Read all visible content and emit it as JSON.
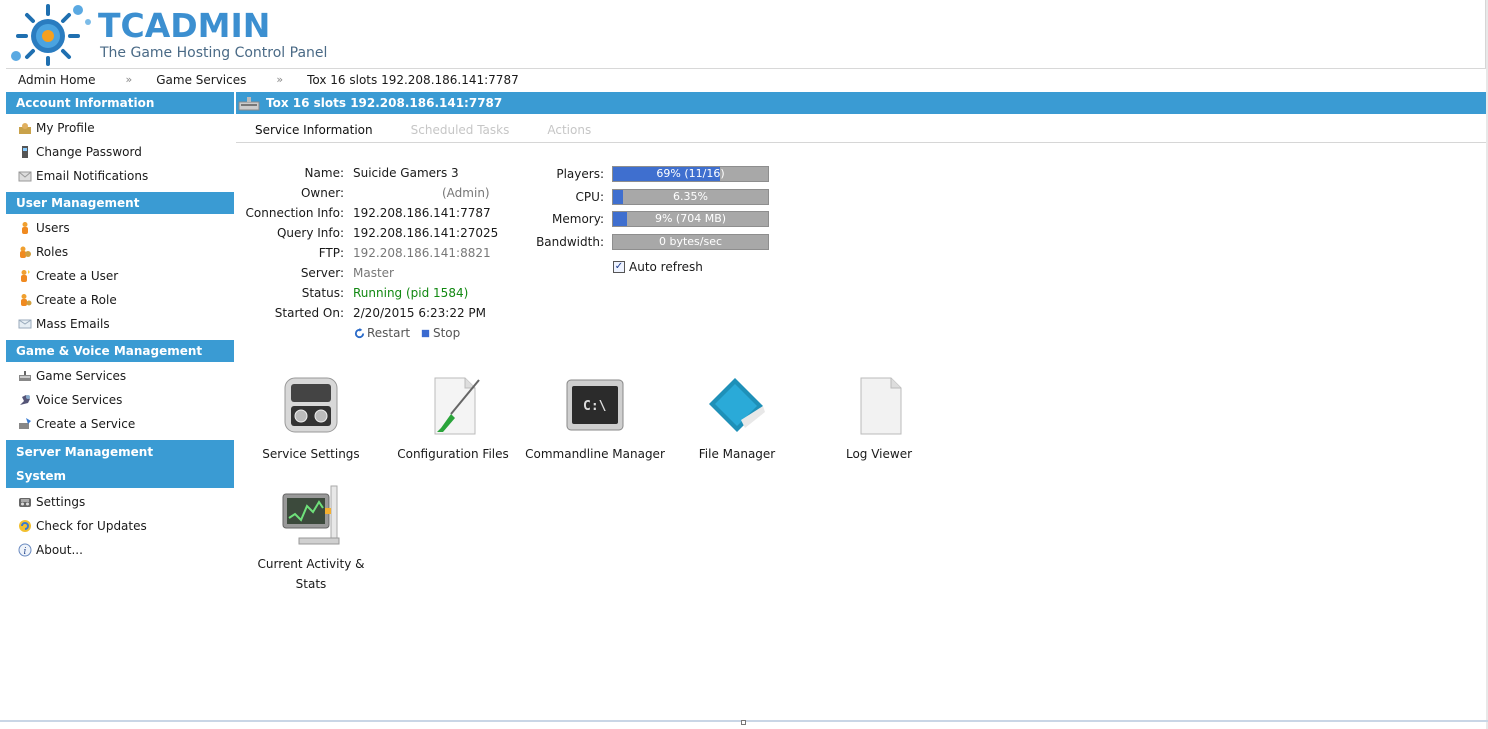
{
  "logo": {
    "title": "TCADMIN",
    "subtitle": "The Game Hosting Control Panel"
  },
  "breadcrumb": [
    "Admin Home",
    "Game Services",
    "Tox 16 slots 192.208.186.141:7787"
  ],
  "breadcrumb_separator": "»",
  "sidebar": {
    "account": {
      "title": "Account Information",
      "items": [
        {
          "label": "My Profile",
          "icon": "profile-icon"
        },
        {
          "label": "Change Password",
          "icon": "password-icon"
        },
        {
          "label": "Email Notifications",
          "icon": "email-icon"
        }
      ]
    },
    "users": {
      "title": "User Management",
      "items": [
        {
          "label": "Users",
          "icon": "user-icon"
        },
        {
          "label": "Roles",
          "icon": "roles-icon"
        },
        {
          "label": "Create a User",
          "icon": "create-user-icon"
        },
        {
          "label": "Create a Role",
          "icon": "create-role-icon"
        },
        {
          "label": "Mass Emails",
          "icon": "mass-email-icon"
        }
      ]
    },
    "game": {
      "title": "Game & Voice Management",
      "items": [
        {
          "label": "Game Services",
          "icon": "game-services-icon"
        },
        {
          "label": "Voice Services",
          "icon": "voice-services-icon"
        },
        {
          "label": "Create a Service",
          "icon": "create-service-icon"
        }
      ]
    },
    "server": {
      "title_line1": "Server Management",
      "title_line2": "System",
      "items": [
        {
          "label": "Settings",
          "icon": "settings-icon"
        },
        {
          "label": "Check for Updates",
          "icon": "updates-icon"
        },
        {
          "label": "About...",
          "icon": "info-icon"
        }
      ]
    }
  },
  "main": {
    "title": "Tox 16 slots 192.208.186.141:7787",
    "tabs": [
      {
        "label": "Service Information",
        "state": "active"
      },
      {
        "label": "Scheduled Tasks",
        "state": "disabled"
      },
      {
        "label": "Actions",
        "state": "disabled"
      }
    ],
    "info": {
      "name_label": "Name:",
      "name": "Suicide Gamers 3",
      "owner_label": "Owner:",
      "owner": "(Admin)",
      "connection_label": "Connection Info:",
      "connection": "192.208.186.141:7787",
      "query_label": "Query Info:",
      "query": "192.208.186.141:27025",
      "ftp_label": "FTP:",
      "ftp": "192.208.186.141:8821",
      "server_label": "Server:",
      "server": "Master",
      "status_label": "Status:",
      "status": "Running (pid 1584)",
      "started_label": "Started On:",
      "started": "2/20/2015 6:23:22 PM"
    },
    "controls": {
      "restart": "Restart",
      "stop": "Stop"
    },
    "stats": {
      "players_label": "Players:",
      "players_text": "69% (11/16)",
      "players_pct": 69,
      "cpu_label": "CPU:",
      "cpu_text": "6.35%",
      "cpu_pct": 6.35,
      "memory_label": "Memory:",
      "memory_text": "9% (704 MB)",
      "memory_pct": 9,
      "bandwidth_label": "Bandwidth:",
      "bandwidth_text": "0 bytes/sec",
      "bandwidth_pct": 0,
      "auto_refresh": "Auto refresh",
      "auto_refresh_checked": true
    },
    "launchers": [
      {
        "label": "Service Settings",
        "icon": "service-settings-icon"
      },
      {
        "label": "Configuration Files",
        "icon": "configuration-files-icon"
      },
      {
        "label": "Commandline Manager",
        "icon": "commandline-manager-icon"
      },
      {
        "label": "File Manager",
        "icon": "file-manager-icon"
      },
      {
        "label": "Log Viewer",
        "icon": "log-viewer-icon"
      },
      {
        "label": "Current Activity &",
        "label2": "Stats",
        "icon": "activity-stats-icon"
      }
    ],
    "colors": {
      "accent": "#3a9bd3",
      "bar_fill": "#3f6fcf",
      "bar_bg": "#a8a8a8",
      "status_green": "#118811"
    }
  }
}
